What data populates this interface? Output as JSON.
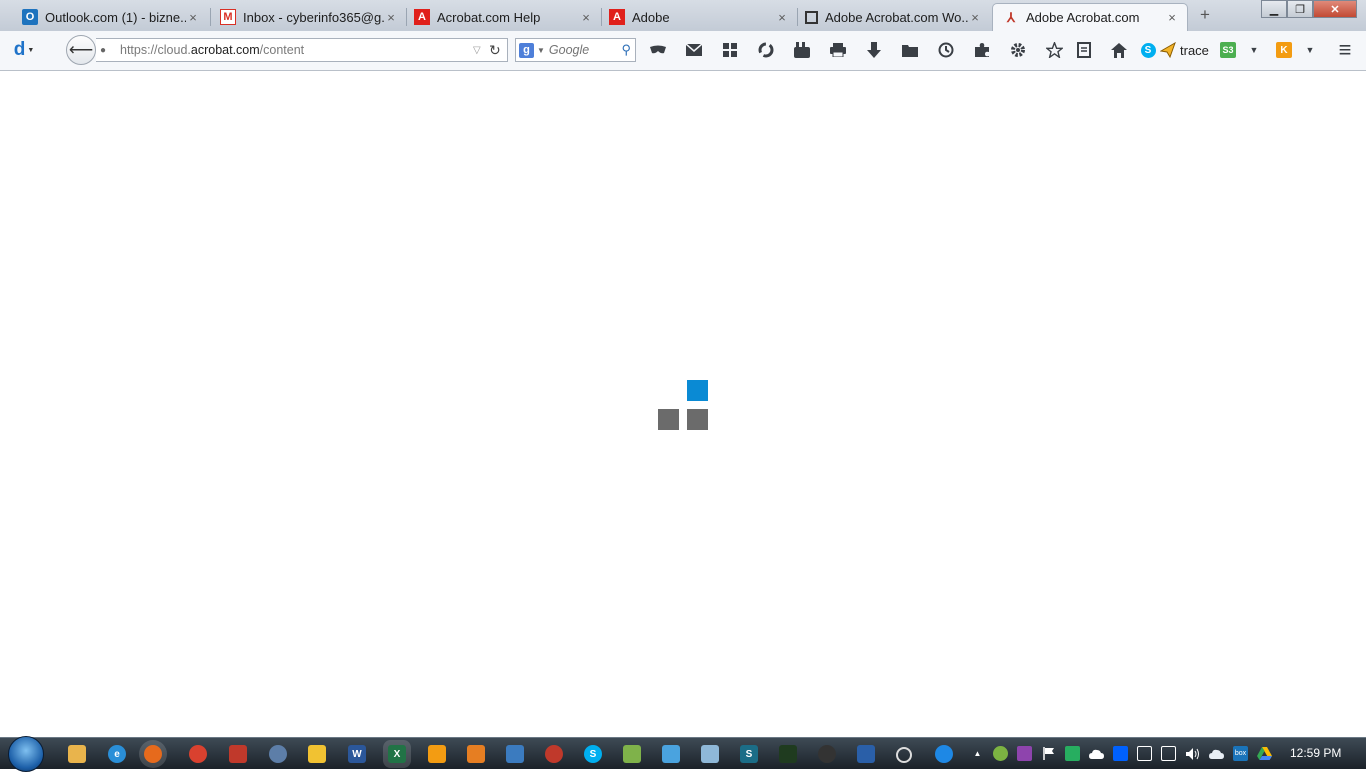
{
  "tabs": [
    {
      "title": "Outlook.com (1) - bizne...",
      "favicon": "outlook-icon",
      "color": "#1e73be",
      "active": false
    },
    {
      "title": "Inbox - cyberinfo365@g...",
      "favicon": "gmail-icon",
      "color": "#d93025",
      "active": false
    },
    {
      "title": "Acrobat.com Help",
      "favicon": "adobe-icon",
      "color": "#e0201b",
      "active": false
    },
    {
      "title": "Adobe",
      "favicon": "adobe-icon",
      "color": "#e0201b",
      "active": false
    },
    {
      "title": "Adobe Acrobat.com Wo...",
      "favicon": "window-icon",
      "color": "#333333",
      "active": false
    },
    {
      "title": "Adobe Acrobat.com",
      "favicon": "acrobat-pdf-icon",
      "color": "#c0392b",
      "active": true
    }
  ],
  "address": {
    "prefix": "https://cloud.",
    "domain": "acrobat.com",
    "path": "/content"
  },
  "search": {
    "placeholder": "Google",
    "engine_letter": "g"
  },
  "toolbar_user": "trace",
  "loader_colors": {
    "active": "#0a8ad4",
    "inactive": "#6b6b6b"
  },
  "clock": "12:59 PM",
  "glyphs": {
    "close": "×",
    "newtab": "+",
    "minimize": "▁",
    "restore": "❐",
    "winclose": "✕",
    "back": "⟵",
    "lock": "🔒",
    "dropdown": "▽",
    "reload": "↻",
    "caret": "▼",
    "search": "⚲",
    "menu": "≡",
    "d": "d",
    "tray_up": "▲"
  }
}
